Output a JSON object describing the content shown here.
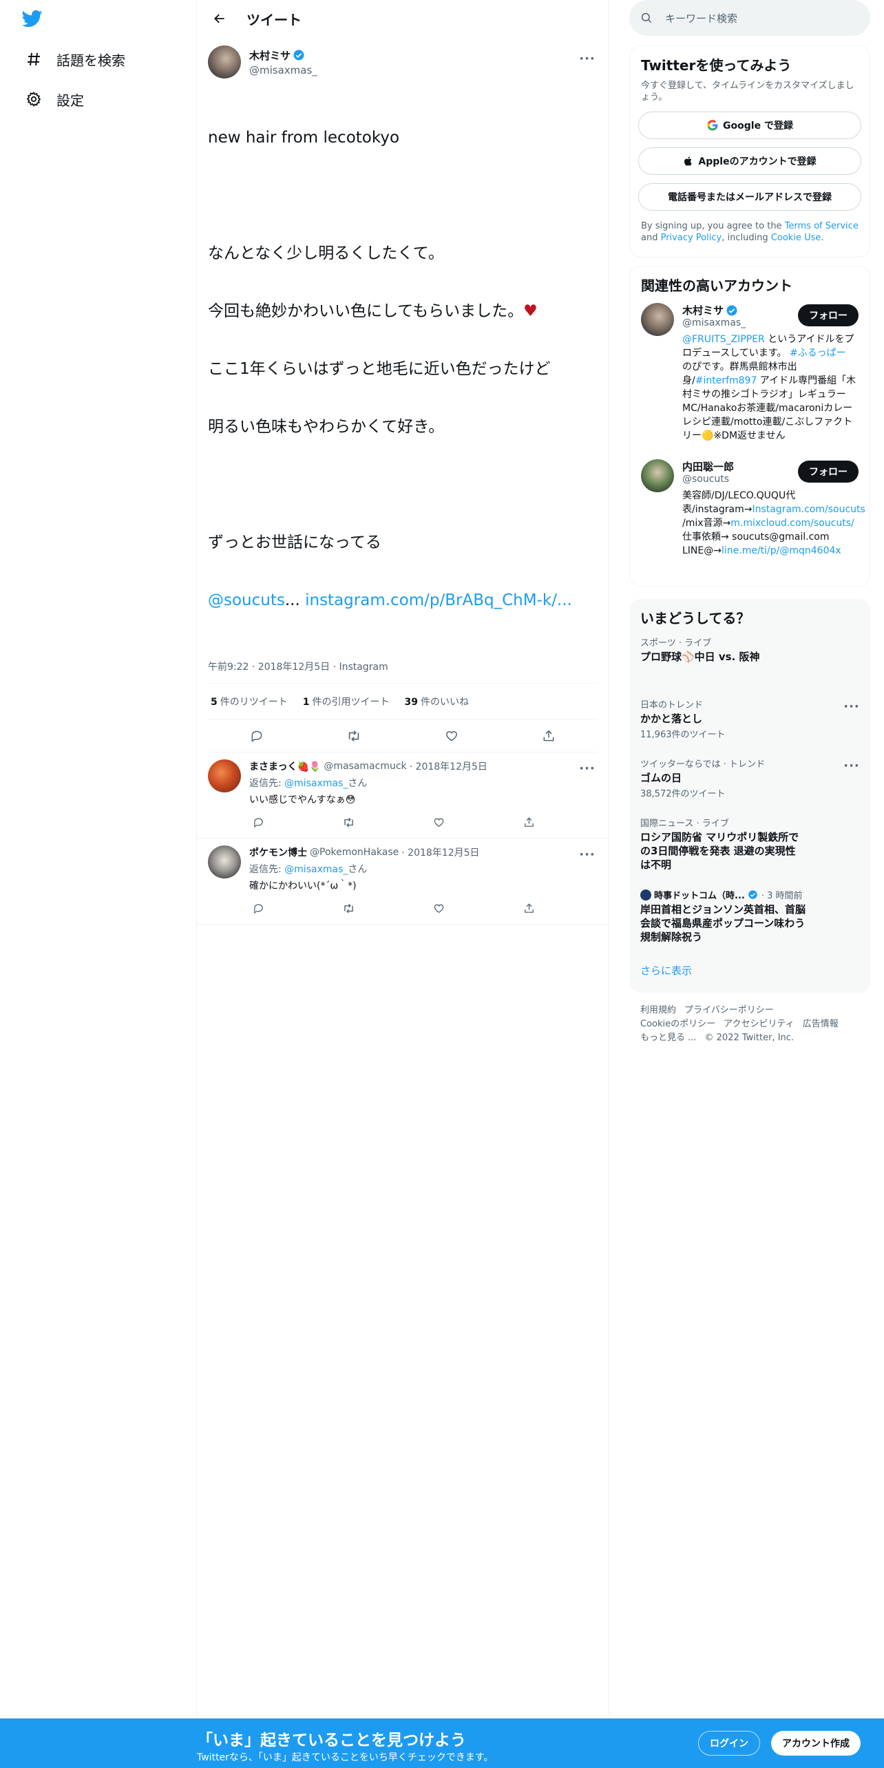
{
  "nav": {
    "explore_label": "話題を検索",
    "settings_label": "設定"
  },
  "header": {
    "title": "ツイート"
  },
  "tweet": {
    "name": "木村ミサ",
    "handle": "@misaxmas_",
    "line1": "new hair from lecotokyo",
    "line2": "",
    "line3": "なんとなく少し明るくしたくて。",
    "line4": "今回も絶妙かわいい色にしてもらいました。",
    "line5": "ここ1年くらいはずっと地毛に近い色だったけど",
    "line6": "明るい色味もやわらかくて好き。",
    "line7": "",
    "line8": "ずっとお世話になってる",
    "mention": "@soucuts",
    "ellipsis": "...",
    "link": "instagram.com/p/BrABq_ChM-k/...",
    "meta": "午前9:22 · 2018年12月5日 · Instagram",
    "retweets": "5",
    "retweets_label": "件のリツイート",
    "quotes": "1",
    "quotes_label": "件の引用ツイート",
    "likes": "39",
    "likes_label": "件のいいね"
  },
  "replies": [
    {
      "name": "まさまっく🍓🌷",
      "handle": "@masamacmuck",
      "date": "· 2018年12月5日",
      "replyto_prefix": "返信先: ",
      "replyto_handle": "@misaxmas_",
      "replyto_suffix": "さん",
      "text": "いい感じでやんすなぁ😳"
    },
    {
      "name": "ポケモン博士",
      "handle": "@PokemonHakase",
      "date": "· 2018年12月5日",
      "replyto_prefix": "返信先: ",
      "replyto_handle": "@misaxmas_",
      "replyto_suffix": "さん",
      "text": "確かにかわいい(*´ω｀*)"
    }
  ],
  "search": {
    "placeholder": "キーワード検索"
  },
  "signup": {
    "title": "Twitterを使ってみよう",
    "subtitle": "今すぐ登録して、タイムラインをカスタマイズしましょう。",
    "google": "Google で登録",
    "apple": "Appleのアカウントで登録",
    "phone": "電話番号またはメールアドレスで登録",
    "terms_a": "By signing up, you agree to the ",
    "terms_tos": "Terms of Service",
    "terms_b": " and ",
    "terms_pp": "Privacy Policy",
    "terms_c": ", including ",
    "terms_cookie": "Cookie Use",
    "terms_d": "."
  },
  "related": {
    "title": "関連性の高いアカウント",
    "follow_label": "フォロー",
    "accounts": [
      {
        "name": "木村ミサ",
        "handle": "@misaxmas_",
        "bio_mention": "@FRUITS_ZIPPER",
        "bio_a": " というアイドルをプロデュースしています。 ",
        "bio_tag1": "#ふるっぱー",
        "bio_b": " のぴです。群馬県館林市出身/",
        "bio_tag2": "#interfm897",
        "bio_c": " アイドル専門番組「木村ミサの推シゴトラジオ」レギュラーMC/Hanakoお茶連載/macaroniカレーレシピ連載/motto連載/こぶしファクトリー🟡※DM返せません"
      },
      {
        "name": "内田聡一郎",
        "handle": "@soucuts",
        "bio_a": "美容師/DJ/LECO.QUQU代表/instagram→",
        "bio_link1": "Instagram.com/soucuts",
        "bio_b": " /mix音源→",
        "bio_link2": "m.mixcloud.com/soucuts/",
        "bio_c": " 仕事依頼→ soucuts@gmail.com LINE@→",
        "bio_link3": "line.me/ti/p/@mqn4604x"
      }
    ]
  },
  "trends": {
    "title": "いまどうしてる？",
    "items": [
      {
        "context": "スポーツ · ライブ",
        "title": "プロ野球⚾中日 vs. 阪神",
        "count": ""
      },
      {
        "context": "日本のトレンド",
        "title": "かかと落とし",
        "count": "11,963件のツイート"
      },
      {
        "context": "ツイッターならでは · トレンド",
        "title": "ゴムの日",
        "count": "38,572件のツイート"
      },
      {
        "context": "国際ニュース · ライブ",
        "title": "ロシア国防省 マリウポリ製鉄所での3日間停戦を発表 退避の実現性は不明",
        "count": ""
      }
    ],
    "news": {
      "source": "時事ドットコム（時...",
      "time": "· 3 時間前",
      "title": "岸田首相とジョンソン英首相、首脳会談で福島県産ポップコーン味わう　規制解除祝う"
    },
    "show_more": "さらに表示"
  },
  "footer": {
    "terms": "利用規約",
    "privacy": "プライバシーポリシー",
    "cookie": "Cookieのポリシー",
    "accessibility": "アクセシビリティ",
    "ads": "広告情報",
    "more": "もっと見る ...",
    "copyright": "© 2022 Twitter, Inc."
  },
  "banner": {
    "title": "「いま」起きていることを見つけよう",
    "subtitle": "Twitterなら、「いま」起きていることをいち早くチェックできます。",
    "login": "ログイン",
    "signup": "アカウント作成"
  },
  "colors": {
    "accent": "#1d9bf0",
    "text": "#0f1419",
    "muted": "#536471"
  }
}
